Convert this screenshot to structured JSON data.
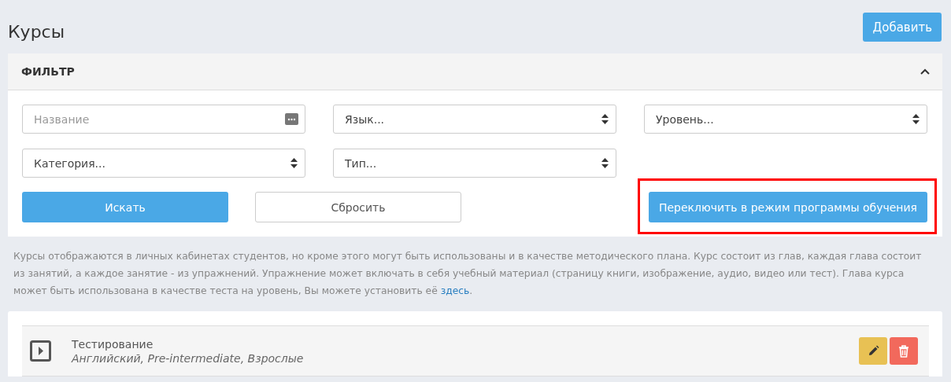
{
  "page": {
    "title": "Курсы",
    "add_button": "Добавить"
  },
  "filter": {
    "title": "ФИЛЬТР",
    "expanded": true,
    "fields": [
      {
        "kind": "text",
        "placeholder": "Название"
      },
      {
        "kind": "select",
        "value": "Язык..."
      },
      {
        "kind": "select",
        "value": "Уровень..."
      },
      {
        "kind": "select",
        "value": "Категория..."
      },
      {
        "kind": "select",
        "value": "Тип..."
      }
    ],
    "buttons": [
      {
        "label": "Искать",
        "kind": "primary",
        "highlighted": false
      },
      {
        "label": "Сбросить",
        "kind": "outline",
        "highlighted": false
      },
      {
        "label": "Переключить в режим программы обучения",
        "kind": "primary",
        "highlighted": true
      }
    ]
  },
  "description": {
    "text": "Курсы отображаются в личных кабинетах студентов, но кроме этого могут быть использованы и в качестве методического плана. Курс состоит из глав, каждая глава состоит из занятий, а каждое занятие - из упражнений. Упражнение может включать в себя учебный материал (страницу книги, изображение, аудио, видео или тест). Глава курса может быть использована в качестве теста на уровень, Вы можете установить её ",
    "link": "здесь",
    "tail": "."
  },
  "courses": [
    {
      "title": "Тестирование",
      "subtitle": "Английский, Pre-intermediate, Взрослые"
    }
  ]
}
